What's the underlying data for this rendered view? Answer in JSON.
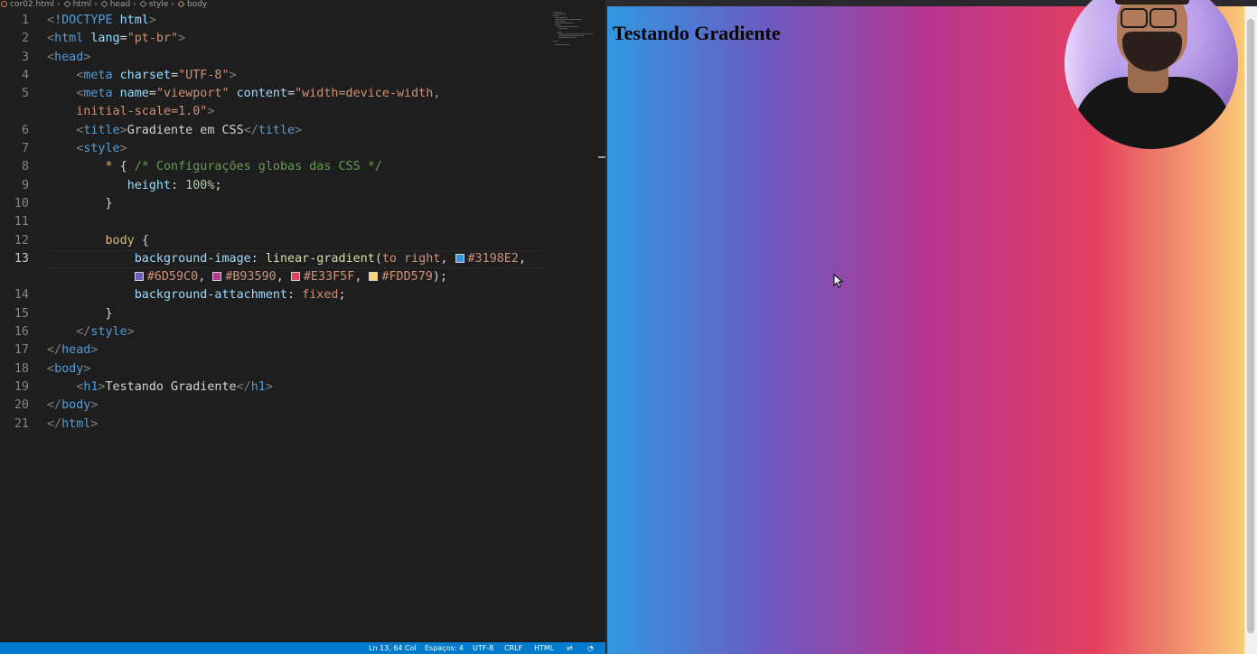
{
  "breadcrumb": {
    "file": "cor02.html",
    "items": [
      "html",
      "head",
      "style",
      "body"
    ]
  },
  "code_lines": [
    {
      "num": "1"
    },
    {
      "num": "2"
    },
    {
      "num": "3"
    },
    {
      "num": "4"
    },
    {
      "num": "5"
    },
    {
      "num": ""
    },
    {
      "num": "6"
    },
    {
      "num": "7"
    },
    {
      "num": "8"
    },
    {
      "num": "9"
    },
    {
      "num": "10"
    },
    {
      "num": "11"
    },
    {
      "num": "12"
    },
    {
      "num": "13"
    },
    {
      "num": ""
    },
    {
      "num": "14"
    },
    {
      "num": "15"
    },
    {
      "num": "16"
    },
    {
      "num": "17"
    },
    {
      "num": "18"
    },
    {
      "num": "19"
    },
    {
      "num": "20"
    },
    {
      "num": "21"
    }
  ],
  "code": {
    "doctype": "!DOCTYPE",
    "doctype_html": "html",
    "html_tag": "html",
    "lang_attr": "lang",
    "lang_val": "\"pt-br\"",
    "head_tag": "head",
    "meta_tag": "meta",
    "charset_attr": "charset",
    "charset_val": "\"UTF-8\"",
    "name_attr": "name",
    "name_val": "\"viewport\"",
    "content_attr": "content",
    "content_val_1": "\"width=device-width,",
    "content_val_2": "initial-scale=1.0\"",
    "title_tag": "title",
    "title_text": "Gradiente em CSS",
    "style_tag": "style",
    "universal_selector": "*",
    "comment": "/* Configurações globas das CSS */",
    "height_prop": "height",
    "height_val": "100%",
    "body_selector": "body",
    "bg_image_prop": "background-image",
    "lg_func": "linear-gradient",
    "to_right": "to right",
    "color1": "#3198E2",
    "color2": "#6D59C0",
    "color3": "#B93590",
    "color4": "#E33F5F",
    "color5": "#FDD579",
    "bg_attach_prop": "background-attachment",
    "bg_attach_val": "fixed",
    "body_tag": "body",
    "h1_tag": "h1",
    "h1_text": "Testando Gradiente"
  },
  "colors": {
    "swatch1": "#3198E2",
    "swatch2": "#6D59C0",
    "swatch3": "#B93590",
    "swatch4": "#E33F5F",
    "swatch5": "#FDD579"
  },
  "status_bar": {
    "position": "Ln 13, 64 Col",
    "spaces": "Espaços: 4",
    "encoding": "UTF-8",
    "eol": "CRLF",
    "language": "HTML"
  },
  "preview": {
    "heading": "Testando Gradiente"
  }
}
